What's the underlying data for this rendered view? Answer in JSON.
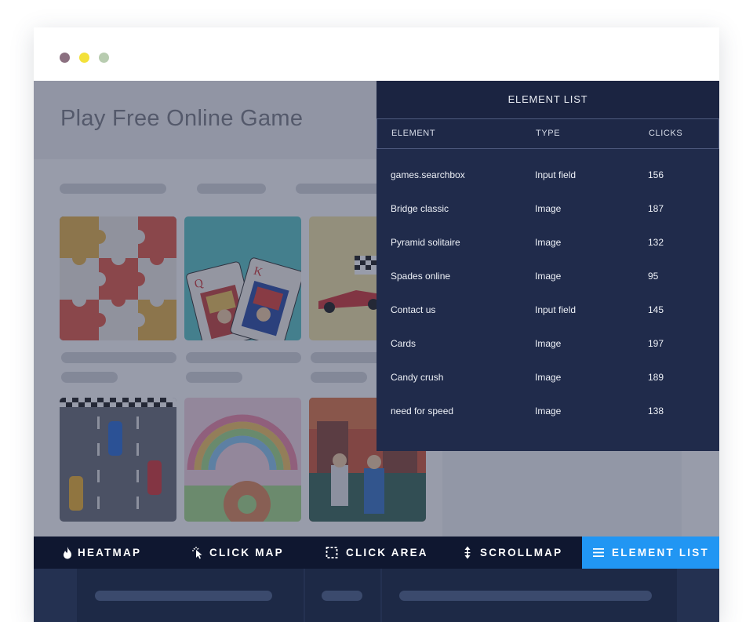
{
  "site": {
    "title": "Play Free Online Game"
  },
  "element_list": {
    "title": "ELEMENT LIST",
    "columns": [
      "ELEMENT",
      "TYPE",
      "CLICKS"
    ],
    "rows": [
      {
        "element": "games.searchbox",
        "type": "Input field",
        "clicks": "156"
      },
      {
        "element": "Bridge classic",
        "type": "Image",
        "clicks": "187"
      },
      {
        "element": "Pyramid solitaire",
        "type": "Image",
        "clicks": "132"
      },
      {
        "element": "Spades online",
        "type": "Image",
        "clicks": "95"
      },
      {
        "element": "Contact us",
        "type": "Input field",
        "clicks": "145"
      },
      {
        "element": "Cards",
        "type": "Image",
        "clicks": "197"
      },
      {
        "element": "Candy crush",
        "type": "Image",
        "clicks": "189"
      },
      {
        "element": "need for speed",
        "type": "Image",
        "clicks": "138"
      }
    ]
  },
  "toolbar": {
    "tabs": [
      {
        "label": "HEATMAP",
        "icon": "flame-icon"
      },
      {
        "label": "CLICK MAP",
        "icon": "pointer-click-icon"
      },
      {
        "label": "CLICK AREA",
        "icon": "dashed-square-icon"
      },
      {
        "label": "SCROLLMAP",
        "icon": "vertical-arrows-icon"
      },
      {
        "label": "ELEMENT LIST",
        "icon": "list-icon"
      }
    ],
    "active_tab": "ELEMENT LIST"
  },
  "colors": {
    "accent": "#2196f3",
    "panel": "#202b4b",
    "toolbar": "#0f1730"
  }
}
